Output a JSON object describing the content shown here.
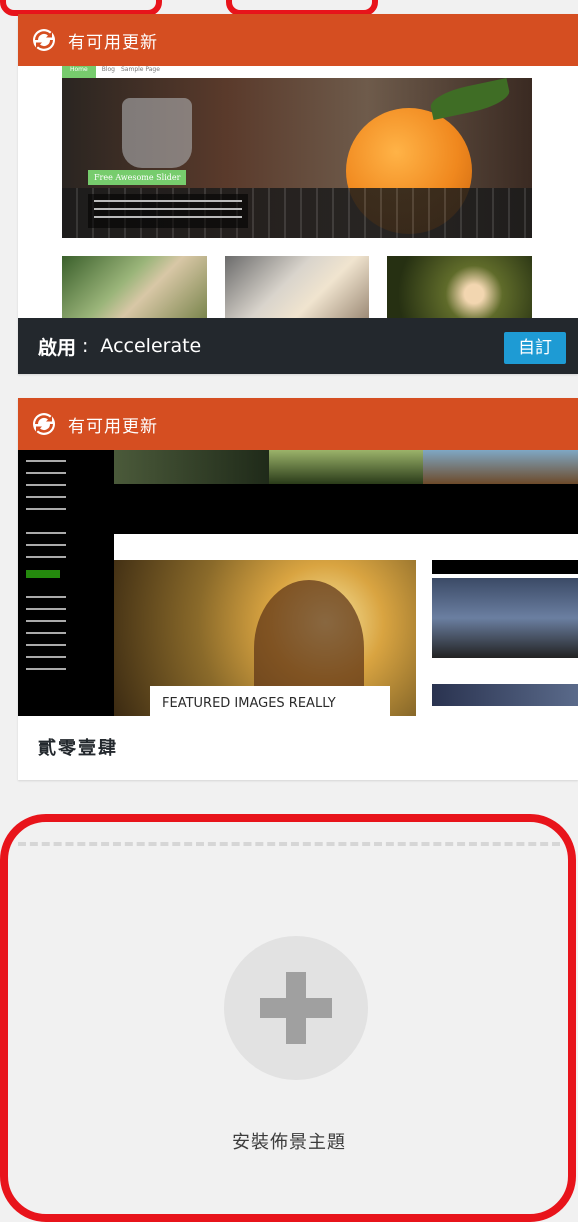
{
  "themes": [
    {
      "update_notice": "有可用更新",
      "active_label": "啟用",
      "active_colon": ":",
      "name": "Accelerate",
      "customize_label": "自訂",
      "preview": {
        "nav": [
          "Home",
          "Blog",
          "Sample Page"
        ],
        "badge": "Free Awesome Slider"
      }
    },
    {
      "update_notice": "有可用更新",
      "name": "貳零壹肆",
      "preview": {
        "featured_title": "FEATURED IMAGES REALLY"
      }
    }
  ],
  "add_new": {
    "label": "安裝佈景主題"
  },
  "colors": {
    "update_bar": "#d54e21",
    "active_bar": "#23282d",
    "customize_button": "#1e9bd4",
    "highlight": "#e8141b"
  }
}
